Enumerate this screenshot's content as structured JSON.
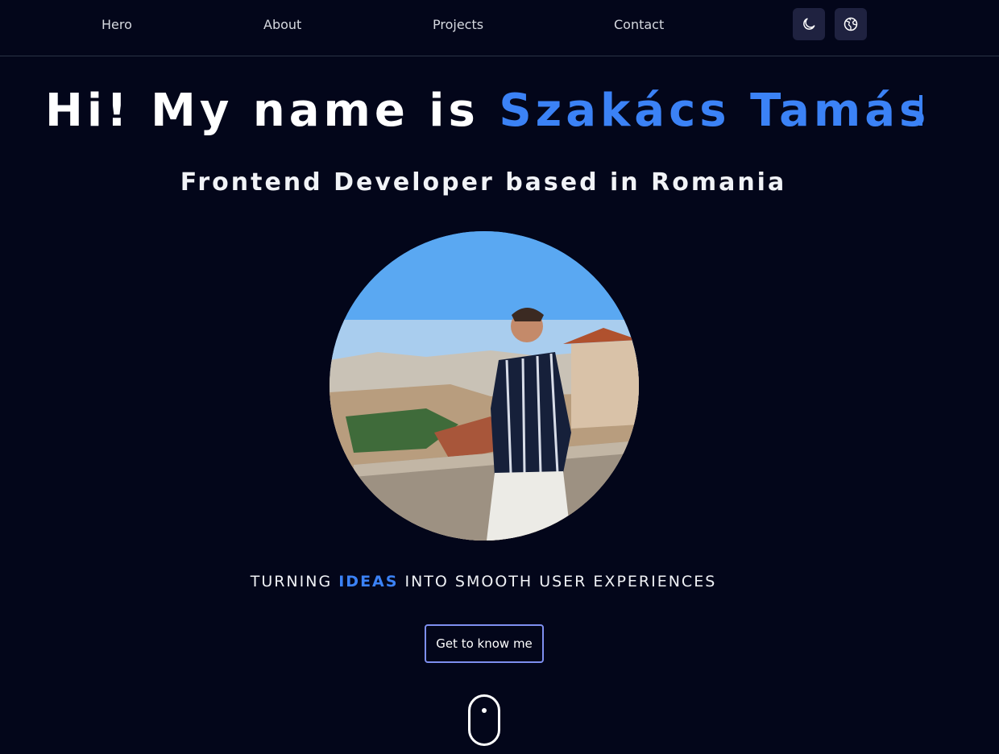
{
  "nav": {
    "links": [
      "Hero",
      "About",
      "Projects",
      "Contact"
    ],
    "theme_icon": "moon-icon",
    "globe_icon": "globe-icon"
  },
  "hero": {
    "greeting": "Hi! My name is ",
    "name": "Szakács Tamás",
    "subtitle": "Frontend Developer based in Romania",
    "tagline_before": "TURNING ",
    "tagline_highlight": "IDEAS",
    "tagline_after": " INTO SMOOTH USER EXPERIENCES",
    "cta_label": "Get to know me",
    "scroll_icon": "mouse-scroll-icon"
  },
  "colors": {
    "background": "#03061a",
    "accent": "#3b82f6",
    "button_border": "#7e8ff0",
    "icon_button_bg": "#1f2240"
  }
}
